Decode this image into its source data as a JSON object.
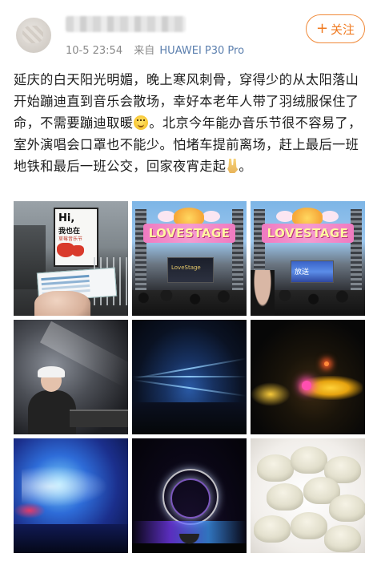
{
  "header": {
    "time": "10-5 23:54",
    "source_prefix": "来自",
    "device": "HUAWEI P30 Pro",
    "follow_label": "关注",
    "follow_plus": "+",
    "accent_color": "#f07a20"
  },
  "post": {
    "text_part1": "延庆的白天阳光明媚，晚上寒风刺骨，穿得少的从太阳落山开始蹦迪直到音乐会散场，幸好本老年人带了羽绒服保住了命，不需要蹦迪取暖",
    "emoji1": "smile-emoji",
    "text_part2": "。北京今年能办音乐节很不容易了，室外演唱会口罩也不能少。怕堵车提前离场，赶上最后一班地铁和最后一班公交，回家夜宵走起",
    "emoji2": "victory-hand-emoji",
    "text_part3": "。"
  },
  "photos": {
    "p1": {
      "sign_line1": "Hi,",
      "sign_line2": "我也在",
      "sign_line3": "草莓音乐节"
    },
    "p2": {
      "banner": "LOVESTAGE",
      "screen_text": "LoveStage"
    },
    "p3": {
      "banner": "LOVESTAGE",
      "screen_text": "放送"
    }
  }
}
